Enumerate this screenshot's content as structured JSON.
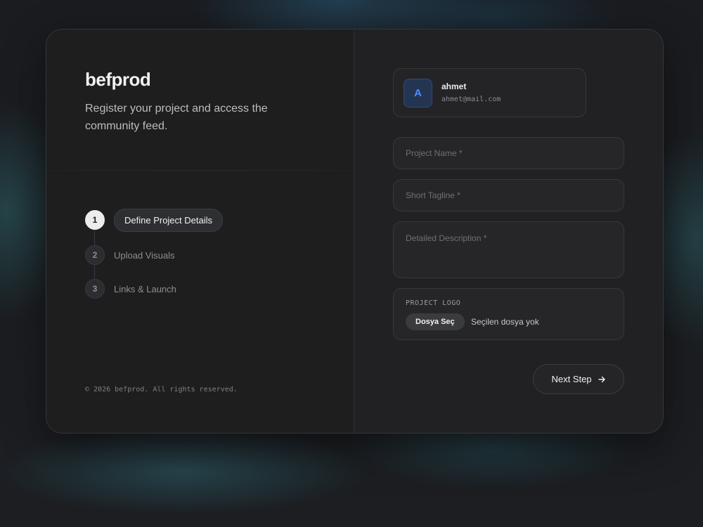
{
  "brand": {
    "name": "befprod",
    "tagline": "Register your project and access the community feed."
  },
  "steps": [
    {
      "number": "1",
      "label": "Define Project Details"
    },
    {
      "number": "2",
      "label": "Upload Visuals"
    },
    {
      "number": "3",
      "label": "Links & Launch"
    }
  ],
  "footer": {
    "copyright": "© 2026 befprod. All rights reserved."
  },
  "user": {
    "initial": "A",
    "name": "ahmet",
    "email": "ahmet@mail.com"
  },
  "form": {
    "project_name": {
      "placeholder": "Project Name *",
      "value": ""
    },
    "short_tagline": {
      "placeholder": "Short Tagline *",
      "value": ""
    },
    "description": {
      "placeholder": "Detailed Description *",
      "value": ""
    },
    "logo": {
      "label": "PROJECT LOGO",
      "button": "Dosya Seç",
      "status": "Seçilen dosya yok"
    }
  },
  "actions": {
    "next_label": "Next Step"
  },
  "colors": {
    "accent": "#4c8dff",
    "card_bg": "#212123",
    "panel_bg": "#1e1e1f"
  }
}
